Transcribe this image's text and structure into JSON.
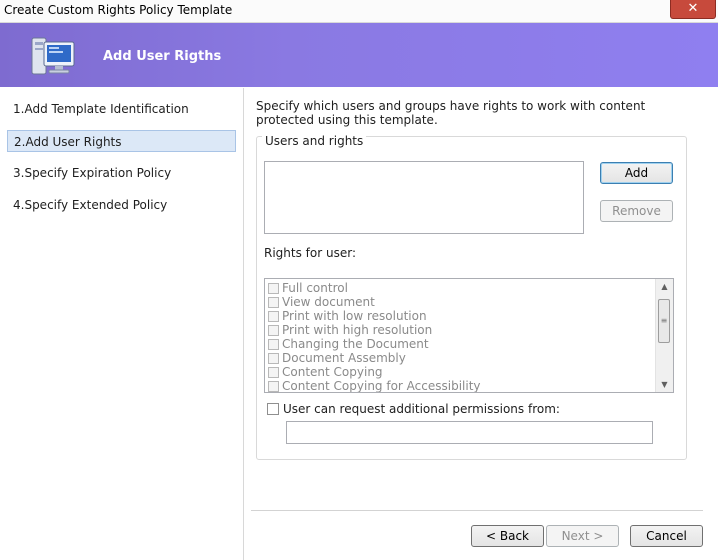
{
  "window": {
    "title": "Create Custom Rights Policy Template",
    "close_glyph": "✕"
  },
  "header": {
    "title": "Add User Rigths",
    "icon": "computer-monitor-icon"
  },
  "steps": [
    {
      "label": "1.Add Template Identification",
      "active": false
    },
    {
      "label": "2.Add User Rights",
      "active": true
    },
    {
      "label": "3.Specify Expiration Policy",
      "active": false
    },
    {
      "label": "4.Specify Extended Policy",
      "active": false
    }
  ],
  "main": {
    "description": "Specify which users and groups have rights to work with content protected using this template.",
    "group_label": "Users and rights",
    "add_button": "Add",
    "remove_button": "Remove",
    "rights_label": "Rights for user:",
    "rights": [
      "Full control",
      "View document",
      "Print with low resolution",
      "Print with high resolution",
      "Changing the Document",
      "Document Assembly",
      "Content Copying",
      "Content Copying for Accessibility"
    ],
    "request_checkbox_label": "User can request additional permissions from:",
    "request_input_value": ""
  },
  "footer": {
    "back": "< Back",
    "next": "Next >",
    "cancel": "Cancel"
  },
  "colors": {
    "header_gradient_start": "#7e6bd0",
    "header_gradient_end": "#8f7ff0",
    "active_step_bg": "#dce8f7"
  }
}
